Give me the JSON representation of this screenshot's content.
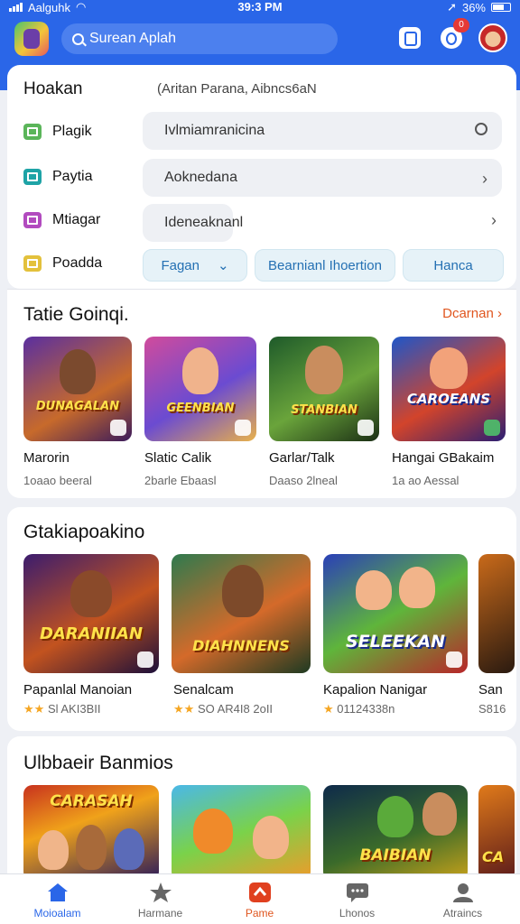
{
  "status": {
    "carrier": "Aalguhk",
    "time": "39:3 PM",
    "battery": "36%"
  },
  "header": {
    "search_text": "Surean Aplah",
    "notification_count": "0"
  },
  "filters": {
    "title": "Hoakan",
    "subtitle": "(Aritan Parana, Aibncs6aN",
    "rows": [
      {
        "label": "Plagik",
        "value": "Ivlmiamranicina"
      },
      {
        "label": "Paytia",
        "value": "Aoknedana"
      },
      {
        "label": "Mtiagar",
        "value": "Ideneaknanl"
      },
      {
        "label": "Poadda"
      }
    ],
    "chips": [
      "Fagan",
      "Bearnianl Ihoertion",
      "Hanca"
    ]
  },
  "sections": [
    {
      "title": "Tatie Goinqi.",
      "see_all": "Dcarnan",
      "items": [
        {
          "art": "DUNAGALAN",
          "name": "Marorin",
          "meta": "1oaao beeral"
        },
        {
          "art": "GEENBIAN",
          "name": "Slatic Calik",
          "meta": "2barle Ebaasl"
        },
        {
          "art": "STANBIAN",
          "name": "Garlar/Talk",
          "meta": "Daaso 2lneal"
        },
        {
          "art": "CAROEANS",
          "name": "Hangai GBakaim",
          "meta": "1a ao Aessal"
        }
      ]
    },
    {
      "title": "Gtakiapoakino",
      "items": [
        {
          "art": "DARANIIAN",
          "name": "Papanlal Manoian",
          "rating": "★★",
          "meta": "Sl AKI3BII"
        },
        {
          "art": "DIAHNNENS",
          "name": "Senalcam",
          "rating": "★★",
          "meta": "SO AR4I8 2oII"
        },
        {
          "art": "SELEEKAN",
          "name": "Kapalion Nanigar",
          "rating": "★",
          "meta": "01124338n"
        },
        {
          "art": "",
          "name": "San",
          "rating": "",
          "meta": "S816"
        }
      ]
    },
    {
      "title": "Ulbbaeir Banmios",
      "items": [
        {
          "art": "CARASAH"
        },
        {
          "art": ""
        },
        {
          "art": "BAIBIAN"
        },
        {
          "art": "CA"
        }
      ]
    }
  ],
  "nav": [
    {
      "label": "Moioalam",
      "icon": "home-icon"
    },
    {
      "label": "Harmane",
      "icon": "star-icon"
    },
    {
      "label": "Pame",
      "icon": "game-icon"
    },
    {
      "label": "Lhonos",
      "icon": "chat-icon"
    },
    {
      "label": "Atraincs",
      "icon": "profile-icon"
    }
  ]
}
